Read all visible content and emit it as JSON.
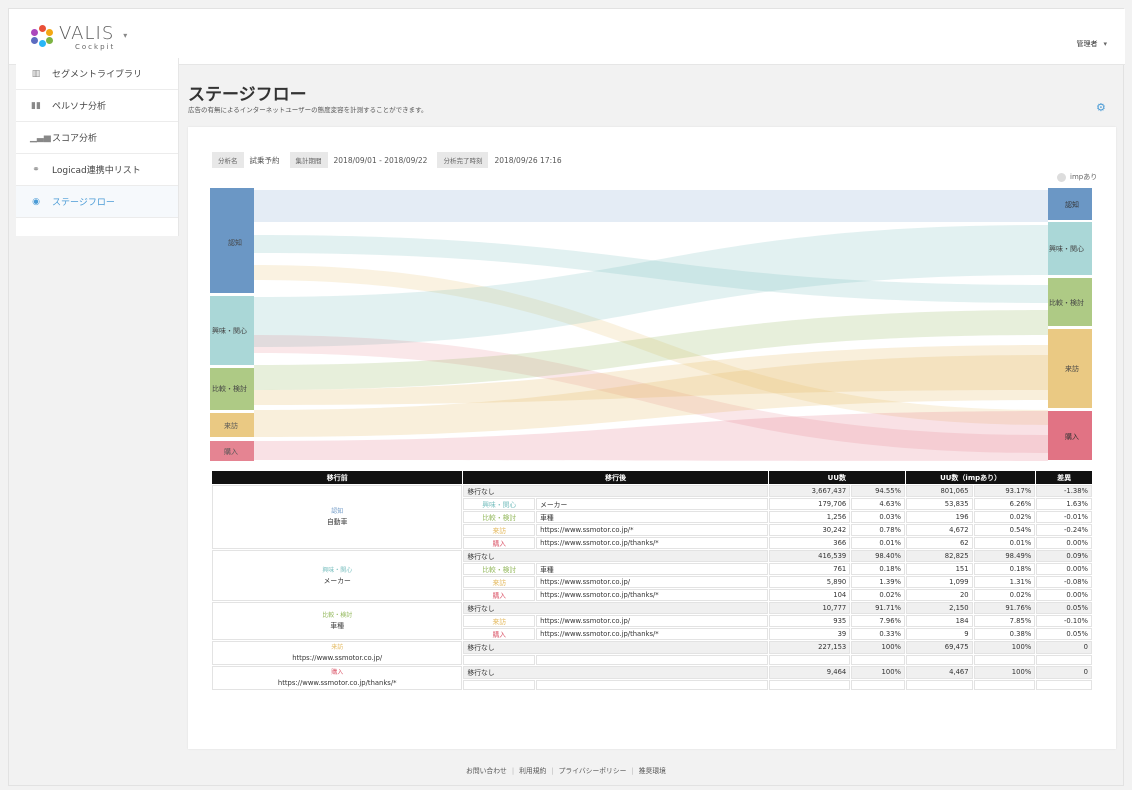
{
  "app": {
    "logo_name": "VALIS",
    "logo_sub": "Cockpit",
    "admin_label": "管理者"
  },
  "sidebar": {
    "items": [
      {
        "label": "セグメントライブラリ",
        "icon": "library-icon"
      },
      {
        "label": "ペルソナ分析",
        "icon": "persona-icon"
      },
      {
        "label": "スコア分析",
        "icon": "bar-chart-icon"
      },
      {
        "label": "Logicad連携中リスト",
        "icon": "link-icon"
      },
      {
        "label": "ステージフロー",
        "icon": "eye-icon"
      }
    ]
  },
  "page": {
    "title": "ステージフロー",
    "description": "広告の有無によるインターネットユーザーの態度変容を計測することができます。"
  },
  "meta": {
    "name_label": "分析名",
    "name_value": "試乗予約",
    "period_label": "集計期間",
    "period_value": "2018/09/01 - 2018/09/22",
    "done_label": "分析完了時刻",
    "done_value": "2018/09/26 17:16"
  },
  "imp_toggle_label": "impあり",
  "colors": {
    "ninchi": "#6b97c5",
    "kyomi": "#7cc1c1",
    "hikaku": "#93b85c",
    "raihou": "#e3b75a",
    "konyu": "#dc5b6e"
  },
  "flow": {
    "left_nodes": [
      "認知",
      "興味・関心",
      "比較・検討",
      "来訪",
      "購入"
    ],
    "right_nodes": [
      "認知",
      "興味・関心",
      "比較・検討",
      "来訪",
      "購入"
    ]
  },
  "table": {
    "headers": [
      "移行前",
      "移行後",
      "UU数",
      "UU数（impあり）",
      "差異"
    ],
    "groups": [
      {
        "stage": "認知",
        "stage_class": "s-ninchi",
        "name": "自動車",
        "rows": [
          {
            "stay": "移行なし",
            "uu": "3,667,437",
            "uu_pct": "94.55%",
            "imp": "801,065",
            "imp_pct": "93.17%",
            "diff": "-1.38%"
          },
          {
            "stage": "興味・関心",
            "stage_class": "s-kyomi",
            "target": "メーカー",
            "uu": "179,706",
            "uu_pct": "4.63%",
            "imp": "53,835",
            "imp_pct": "6.26%",
            "diff": "1.63%"
          },
          {
            "stage": "比較・検討",
            "stage_class": "s-hikaku",
            "target": "車種",
            "uu": "1,256",
            "uu_pct": "0.03%",
            "imp": "196",
            "imp_pct": "0.02%",
            "diff": "-0.01%"
          },
          {
            "stage": "来訪",
            "stage_class": "s-raihou",
            "target": "https://www.ssmotor.co.jp/*",
            "uu": "30,242",
            "uu_pct": "0.78%",
            "imp": "4,672",
            "imp_pct": "0.54%",
            "diff": "-0.24%"
          },
          {
            "stage": "購入",
            "stage_class": "s-konyu",
            "target": "https://www.ssmotor.co.jp/thanks/*",
            "uu": "366",
            "uu_pct": "0.01%",
            "imp": "62",
            "imp_pct": "0.01%",
            "diff": "0.00%"
          }
        ]
      },
      {
        "stage": "興味・関心",
        "stage_class": "s-kyomi",
        "name": "メーカー",
        "rows": [
          {
            "stay": "移行なし",
            "uu": "416,539",
            "uu_pct": "98.40%",
            "imp": "82,825",
            "imp_pct": "98.49%",
            "diff": "0.09%"
          },
          {
            "stage": "比較・検討",
            "stage_class": "s-hikaku",
            "target": "車種",
            "uu": "761",
            "uu_pct": "0.18%",
            "imp": "151",
            "imp_pct": "0.18%",
            "diff": "0.00%"
          },
          {
            "stage": "来訪",
            "stage_class": "s-raihou",
            "target": "https://www.ssmotor.co.jp/",
            "uu": "5,890",
            "uu_pct": "1.39%",
            "imp": "1,099",
            "imp_pct": "1.31%",
            "diff": "-0.08%"
          },
          {
            "stage": "購入",
            "stage_class": "s-konyu",
            "target": "https://www.ssmotor.co.jp/thanks/*",
            "uu": "104",
            "uu_pct": "0.02%",
            "imp": "20",
            "imp_pct": "0.02%",
            "diff": "0.00%"
          }
        ]
      },
      {
        "stage": "比較・検討",
        "stage_class": "s-hikaku",
        "name": "車種",
        "rows": [
          {
            "stay": "移行なし",
            "uu": "10,777",
            "uu_pct": "91.71%",
            "imp": "2,150",
            "imp_pct": "91.76%",
            "diff": "0.05%"
          },
          {
            "stage": "来訪",
            "stage_class": "s-raihou",
            "target": "https://www.ssmotor.co.jp/",
            "uu": "935",
            "uu_pct": "7.96%",
            "imp": "184",
            "imp_pct": "7.85%",
            "diff": "-0.10%"
          },
          {
            "stage": "購入",
            "stage_class": "s-konyu",
            "target": "https://www.ssmotor.co.jp/thanks/*",
            "uu": "39",
            "uu_pct": "0.33%",
            "imp": "9",
            "imp_pct": "0.38%",
            "diff": "0.05%"
          }
        ]
      },
      {
        "stage": "来訪",
        "stage_class": "s-raihou",
        "name": "https://www.ssmotor.co.jp/",
        "rows": [
          {
            "stay": "移行なし",
            "uu": "227,153",
            "uu_pct": "100%",
            "imp": "69,475",
            "imp_pct": "100%",
            "diff": "0"
          },
          {
            "blank": true
          }
        ]
      },
      {
        "stage": "購入",
        "stage_class": "s-konyu",
        "name": "https://www.ssmotor.co.jp/thanks/*",
        "rows": [
          {
            "stay": "移行なし",
            "uu": "9,464",
            "uu_pct": "100%",
            "imp": "4,467",
            "imp_pct": "100%",
            "diff": "0"
          },
          {
            "blank": true
          }
        ]
      }
    ]
  },
  "footer": {
    "links": [
      "お問い合わせ",
      "利用規約",
      "プライバシーポリシー",
      "推奨環境"
    ]
  }
}
